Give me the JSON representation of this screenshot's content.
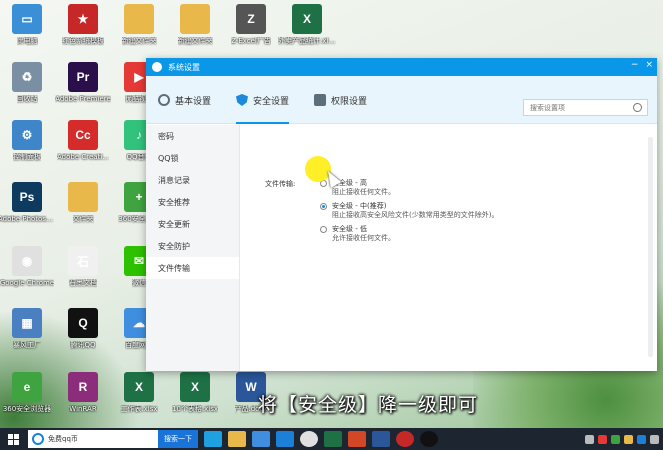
{
  "desktop": {
    "icons": [
      {
        "label": "此电脑",
        "color": "#3b8fd6",
        "glyph": "▭"
      },
      {
        "label": "红色系统模板",
        "color": "#c62828",
        "glyph": "★"
      },
      {
        "label": "新建文件夹",
        "color": "#e8b84a",
        "glyph": ""
      },
      {
        "label": "新建文件夹",
        "color": "#e8b84a",
        "glyph": ""
      },
      {
        "label": "Z-Excel广告",
        "color": "#555555",
        "glyph": "Z"
      },
      {
        "label": "外卖产品统计.xlsx",
        "color": "#1e7145",
        "glyph": "X"
      },
      {
        "label": "回收站",
        "color": "#7a8fa3",
        "glyph": "♻"
      },
      {
        "label": "Adobe Premiere",
        "color": "#2a0f4a",
        "glyph": "Pr"
      },
      {
        "label": "优酷视频",
        "color": "#e53935",
        "glyph": "▶"
      },
      {
        "label": "控制面板",
        "color": "#3e86c9",
        "glyph": "⚙"
      },
      {
        "label": "Adobe Creati...",
        "color": "#d62b2b",
        "glyph": "Cc"
      },
      {
        "label": "QQ音乐",
        "color": "#31c27c",
        "glyph": "♪"
      },
      {
        "label": "Adobe Photosh...",
        "color": "#0e3a5f",
        "glyph": "Ps"
      },
      {
        "label": "文件夹",
        "color": "#e8b84a",
        "glyph": ""
      },
      {
        "label": "360安全卫士",
        "color": "#3fa33f",
        "glyph": "+"
      },
      {
        "label": "Google Chrome",
        "color": "#e0e0e0",
        "glyph": "◉"
      },
      {
        "label": "石墨文档",
        "color": "#f0f0f0",
        "glyph": "石"
      },
      {
        "label": "微信",
        "color": "#2dc100",
        "glyph": "✉"
      },
      {
        "label": "暴风工厂",
        "color": "#4a7fc1",
        "glyph": "▦"
      },
      {
        "label": "腾讯QQ",
        "color": "#111111",
        "glyph": "Q"
      },
      {
        "label": "百度网盘",
        "color": "#3f8ee0",
        "glyph": "☁"
      },
      {
        "label": "360安全浏览器",
        "color": "#3fa33f",
        "glyph": "e"
      },
      {
        "label": "WinRAR",
        "color": "#8b2d7a",
        "glyph": "R"
      },
      {
        "label": "工作表.xlsx",
        "color": "#1e7145",
        "glyph": "X"
      },
      {
        "label": "10个表格.xlsx",
        "color": "#1e7145",
        "glyph": "X"
      },
      {
        "label": "产品.docx",
        "color": "#2b579a",
        "glyph": "W"
      }
    ]
  },
  "window": {
    "title": "系统设置",
    "controls": {
      "minimize": "−",
      "close": "×"
    },
    "tabs": [
      {
        "label": "基本设置"
      },
      {
        "label": "安全设置"
      },
      {
        "label": "权限设置"
      }
    ],
    "search_placeholder": "搜索设置项",
    "sidebar": [
      "密码",
      "QQ锁",
      "消息记录",
      "安全推荐",
      "安全更新",
      "安全防护",
      "文件传输"
    ],
    "file_transfer": {
      "label": "文件传输:",
      "options": [
        {
          "title": "安全级 - 高",
          "desc": "阻止接收任何文件。",
          "selected": false
        },
        {
          "title": "安全级 - 中(推荐)",
          "desc": "阻止接收高安全风险文件(少数常用类型的文件除外)。",
          "selected": true
        },
        {
          "title": "安全级 - 低",
          "desc": "允许接收任何文件。",
          "selected": false
        }
      ]
    }
  },
  "subtitle": "将【安全级】降一级即可",
  "taskbar": {
    "search_text": "免费qq币",
    "search_button": "搜索一下"
  }
}
